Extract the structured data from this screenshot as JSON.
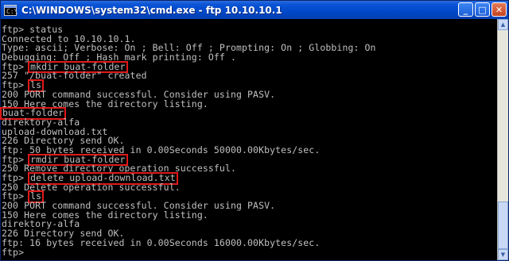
{
  "window": {
    "title": "C:\\WINDOWS\\system32\\cmd.exe - ftp 10.10.10.1",
    "icon": "cmd-icon",
    "buttons": {
      "minimize": "_",
      "maximize": "□",
      "close": "✕"
    }
  },
  "console": {
    "lines": [
      "ftp> status",
      "Connected to 10.10.10.1.",
      "Type: ascii; Verbose: On ; Bell: Off ; Prompting: On ; Globbing: On",
      "Debugging: Off ; Hash mark printing: Off .",
      "ftp> mkdir buat-folder",
      "257 \"/buat-folder\" created",
      "ftp> ls",
      "200 PORT command successful. Consider using PASV.",
      "150 Here comes the directory listing.",
      "buat-folder",
      "direktory-alfa",
      "upload-download.txt",
      "226 Directory send OK.",
      "ftp: 50 bytes received in 0.00Seconds 50000.00Kbytes/sec.",
      "ftp> rmdir buat-folder",
      "250 Remove directory operation successful.",
      "ftp> delete upload-download.txt",
      "250 Delete operation successful.",
      "ftp> ls",
      "200 PORT command successful. Consider using PASV.",
      "150 Here comes the directory listing.",
      "direktory-alfa",
      "226 Directory send OK.",
      "ftp: 16 bytes received in 0.00Seconds 16000.00Kbytes/sec.",
      "ftp>"
    ],
    "highlights": {
      "mkdir": "mkdir buat-folder",
      "ls1": "ls",
      "folder": "buat-folder",
      "rmdir": "rmdir buat-folder",
      "delete": "delete upload-download.txt",
      "ls2": "ls"
    },
    "prompt": "ftp> "
  },
  "colors": {
    "console_text": "#c0c0c0",
    "console_bg": "#000000",
    "highlight_box": "#e01a1a",
    "titlebar": "#0048c8"
  }
}
